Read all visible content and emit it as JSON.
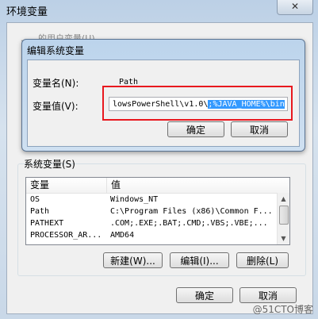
{
  "outer": {
    "title": "环境变量",
    "close_glyph": "✕",
    "ghost_text": "……的用户变量(U)"
  },
  "system_vars": {
    "group_label": "系统变量(S)",
    "headers": [
      "变量",
      "值"
    ],
    "rows": [
      {
        "name": "OS",
        "value": "Windows_NT"
      },
      {
        "name": "Path",
        "value": "C:\\Program Files (x86)\\Common F..."
      },
      {
        "name": "PATHEXT",
        "value": ".COM;.EXE;.BAT;.CMD;.VBS;.VBE;..."
      },
      {
        "name": "PROCESSOR_AR...",
        "value": "AMD64"
      }
    ],
    "new_label": "新建(W)...",
    "edit_label": "编辑(I)...",
    "delete_label": "删除(L)"
  },
  "outer_buttons": {
    "ok_label": "确定",
    "cancel_label": "取消"
  },
  "dialog": {
    "title": "编辑系统变量",
    "name_label": "变量名(N):",
    "name_value": "Path",
    "value_label": "变量值(V):",
    "value_prefix": "lowsPowerShell\\v1.0\\",
    "value_selected": ";%JAVA_HOME%\\bin",
    "ok_label": "确定",
    "cancel_label": "取消"
  },
  "watermark": "@51CTO博客",
  "colors": {
    "highlight_box": "#e8181e",
    "selection": "#3399ff"
  }
}
